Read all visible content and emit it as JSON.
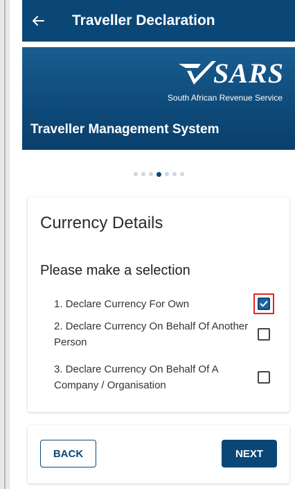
{
  "header": {
    "title": "Traveller Declaration"
  },
  "banner": {
    "logo_text": "SARS",
    "organization": "South African Revenue Service",
    "system_name": "Traveller Management System"
  },
  "stepper": {
    "total_steps": 7,
    "current_step": 4
  },
  "details": {
    "title": "Currency Details",
    "prompt": "Please make a selection",
    "options": [
      {
        "label": "1. Declare Currency For Own",
        "checked": true
      },
      {
        "label": "2. Declare Currency On Behalf Of Another Person",
        "checked": false
      },
      {
        "label": "3. Declare Currency On Behalf Of A Company / Organisation",
        "checked": false
      }
    ]
  },
  "actions": {
    "back_label": "BACK",
    "next_label": "NEXT"
  },
  "colors": {
    "primary": "#0a4777",
    "highlight": "#e32222",
    "checkbox_fill": "#1b65a5"
  }
}
